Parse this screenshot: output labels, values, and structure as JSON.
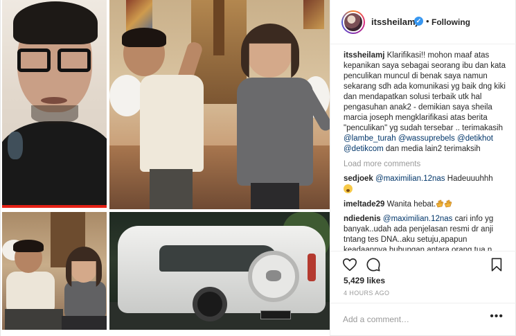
{
  "post": {
    "username": "itssheilamj",
    "verified_badge": "✓",
    "separator": "•",
    "follow_status": "Following"
  },
  "caption": {
    "author": "itssheilamj",
    "text_1": "Klarifikasi!! mohon maaf atas kepanikan saya sebagai seorang ibu dan kata penculikan muncul di benak saya namun sekarang sdh ada komunikasi yg baik dng kiki dan mendapatkan solusi terbaik utk hal pengasuhan anak2 - demikian saya sheila marcia joseph mengklarifikasi atas berita \"penculikan\" yg sudah tersebar .. terimakasih",
    "mention_1": "@lambe_turah",
    "mention_2": "@wassuprebels",
    "mention_3": "@detikhot",
    "mention_4": "@detikcom",
    "text_2": "dan media lain2 terimaksih"
  },
  "load_more": "Load more comments",
  "comments": [
    {
      "author": "sedjoek",
      "mention": "@maximilian.12nas",
      "text": "Hadeuuuhhh",
      "icon": "weary-face-emoji"
    },
    {
      "author": "imeltade29",
      "text": "Wanita hebat.",
      "icon": "clapping-hands-emoji"
    },
    {
      "author": "ndiedenis",
      "mention": "@maximilian.12nas",
      "text": "cari info yg banyak..udah ada penjelasan resmi dr anji tntang tes DNA..aku setuju,apapun keadaannya hubungan antara orang tua n"
    }
  ],
  "actions": {
    "like_icon": "heart-icon",
    "comment_icon": "comment-icon",
    "save_icon": "bookmark-icon"
  },
  "likes_count": "5,429 likes",
  "timestamp": "4 HOURS AGO",
  "add_comment": {
    "placeholder": "Add a comment…",
    "more_label": "•••"
  },
  "colors": {
    "link": "#003569",
    "muted": "#999999",
    "verified": "#3897f0",
    "text": "#262626"
  }
}
